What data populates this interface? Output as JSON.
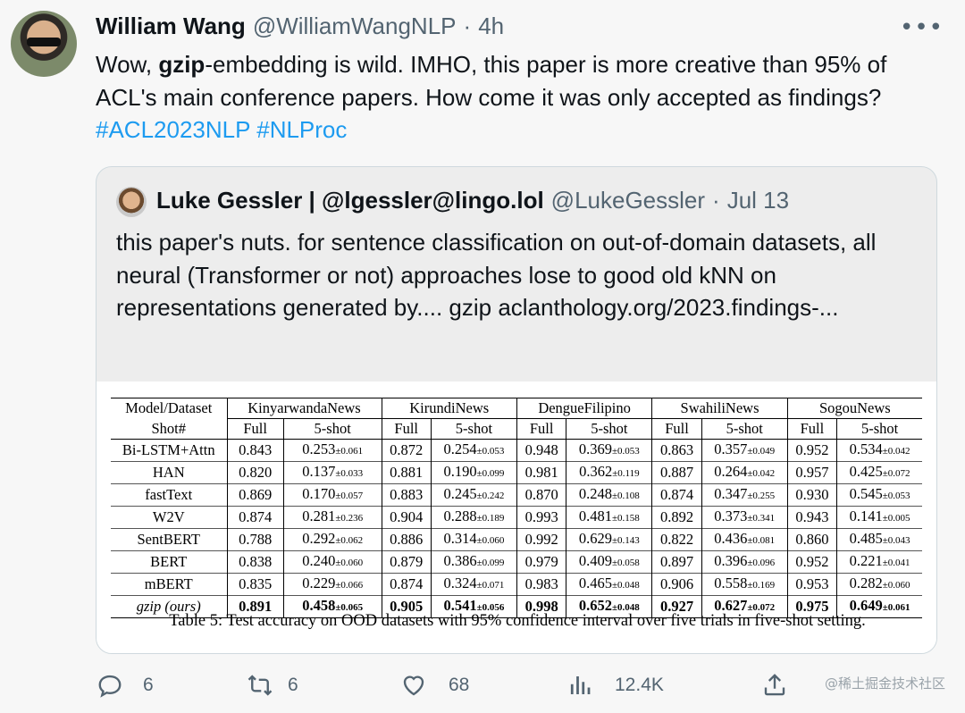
{
  "tweet": {
    "author_name": "William Wang",
    "author_handle": "@WilliamWangNLP",
    "separator": "·",
    "time": "4h",
    "more_label": "•••",
    "text_pre": "Wow, ",
    "text_bold": "gzip",
    "text_post": "-embedding is wild. IMHO, this paper is more creative than 95% of ACL's main conference papers. How come it was only accepted as findings? ",
    "hashtag_1": "#ACL2023NLP",
    "hashtag_2": "#NLProc"
  },
  "quote": {
    "author_name": "Luke Gessler | @lgessler@lingo.lol",
    "author_handle": "@LukeGessler",
    "separator": "·",
    "time": "Jul 13",
    "text": "this paper's nuts. for sentence classification on out-of-domain datasets, all neural (Transformer or not) approaches lose to good old kNN on representations generated by.... gzip aclanthology.org/2023.findings-..."
  },
  "table": {
    "header_model": "Model/Dataset",
    "header_shot": "Shot#",
    "datasets": [
      "KinyarwandaNews",
      "KirundiNews",
      "DengueFilipino",
      "SwahiliNews",
      "SogouNews"
    ],
    "full_label": "Full",
    "fiveshot_label": "5-shot",
    "rows": [
      {
        "model": "Bi-LSTM+Attn",
        "cells": [
          [
            "0.843",
            "0.253",
            "±0.061"
          ],
          [
            "0.872",
            "0.254",
            "±0.053"
          ],
          [
            "0.948",
            "0.369",
            "±0.053"
          ],
          [
            "0.863",
            "0.357",
            "±0.049"
          ],
          [
            "0.952",
            "0.534",
            "±0.042"
          ]
        ]
      },
      {
        "model": "HAN",
        "cells": [
          [
            "0.820",
            "0.137",
            "±0.033"
          ],
          [
            "0.881",
            "0.190",
            "±0.099"
          ],
          [
            "0.981",
            "0.362",
            "±0.119"
          ],
          [
            "0.887",
            "0.264",
            "±0.042"
          ],
          [
            "0.957",
            "0.425",
            "±0.072"
          ]
        ]
      },
      {
        "model": "fastText",
        "cells": [
          [
            "0.869",
            "0.170",
            "±0.057"
          ],
          [
            "0.883",
            "0.245",
            "±0.242"
          ],
          [
            "0.870",
            "0.248",
            "±0.108"
          ],
          [
            "0.874",
            "0.347",
            "±0.255"
          ],
          [
            "0.930",
            "0.545",
            "±0.053"
          ]
        ]
      },
      {
        "model": "W2V",
        "cells": [
          [
            "0.874",
            "0.281",
            "±0.236"
          ],
          [
            "0.904",
            "0.288",
            "±0.189"
          ],
          [
            "0.993",
            "0.481",
            "±0.158"
          ],
          [
            "0.892",
            "0.373",
            "±0.341"
          ],
          [
            "0.943",
            "0.141",
            "±0.005"
          ]
        ]
      },
      {
        "model": "SentBERT",
        "cells": [
          [
            "0.788",
            "0.292",
            "±0.062"
          ],
          [
            "0.886",
            "0.314",
            "±0.060"
          ],
          [
            "0.992",
            "0.629",
            "±0.143"
          ],
          [
            "0.822",
            "0.436",
            "±0.081"
          ],
          [
            "0.860",
            "0.485",
            "±0.043"
          ]
        ]
      },
      {
        "model": "BERT",
        "cells": [
          [
            "0.838",
            "0.240",
            "±0.060"
          ],
          [
            "0.879",
            "0.386",
            "±0.099"
          ],
          [
            "0.979",
            "0.409",
            "±0.058"
          ],
          [
            "0.897",
            "0.396",
            "±0.096"
          ],
          [
            "0.952",
            "0.221",
            "±0.041"
          ]
        ]
      },
      {
        "model": "mBERT",
        "cells": [
          [
            "0.835",
            "0.229",
            "±0.066"
          ],
          [
            "0.874",
            "0.324",
            "±0.071"
          ],
          [
            "0.983",
            "0.465",
            "±0.048"
          ],
          [
            "0.906",
            "0.558",
            "±0.169"
          ],
          [
            "0.953",
            "0.282",
            "±0.060"
          ]
        ]
      },
      {
        "model": "gzip (ours)",
        "cells": [
          [
            "0.891",
            "0.458",
            "±0.065"
          ],
          [
            "0.905",
            "0.541",
            "±0.056"
          ],
          [
            "0.998",
            "0.652",
            "±0.048"
          ],
          [
            "0.927",
            "0.627",
            "±0.072"
          ],
          [
            "0.975",
            "0.649",
            "±0.061"
          ]
        ]
      }
    ],
    "caption": "Table 5: Test accuracy on OOD datasets with 95% confidence interval over five trials in five-shot setting."
  },
  "actions": {
    "replies": "6",
    "retweets": "6",
    "likes": "68",
    "views": "12.4K"
  },
  "watermark": "@稀土掘金技术社区",
  "colors": {
    "hashtag": "#1d9bf0",
    "secondary_text": "#536471"
  }
}
